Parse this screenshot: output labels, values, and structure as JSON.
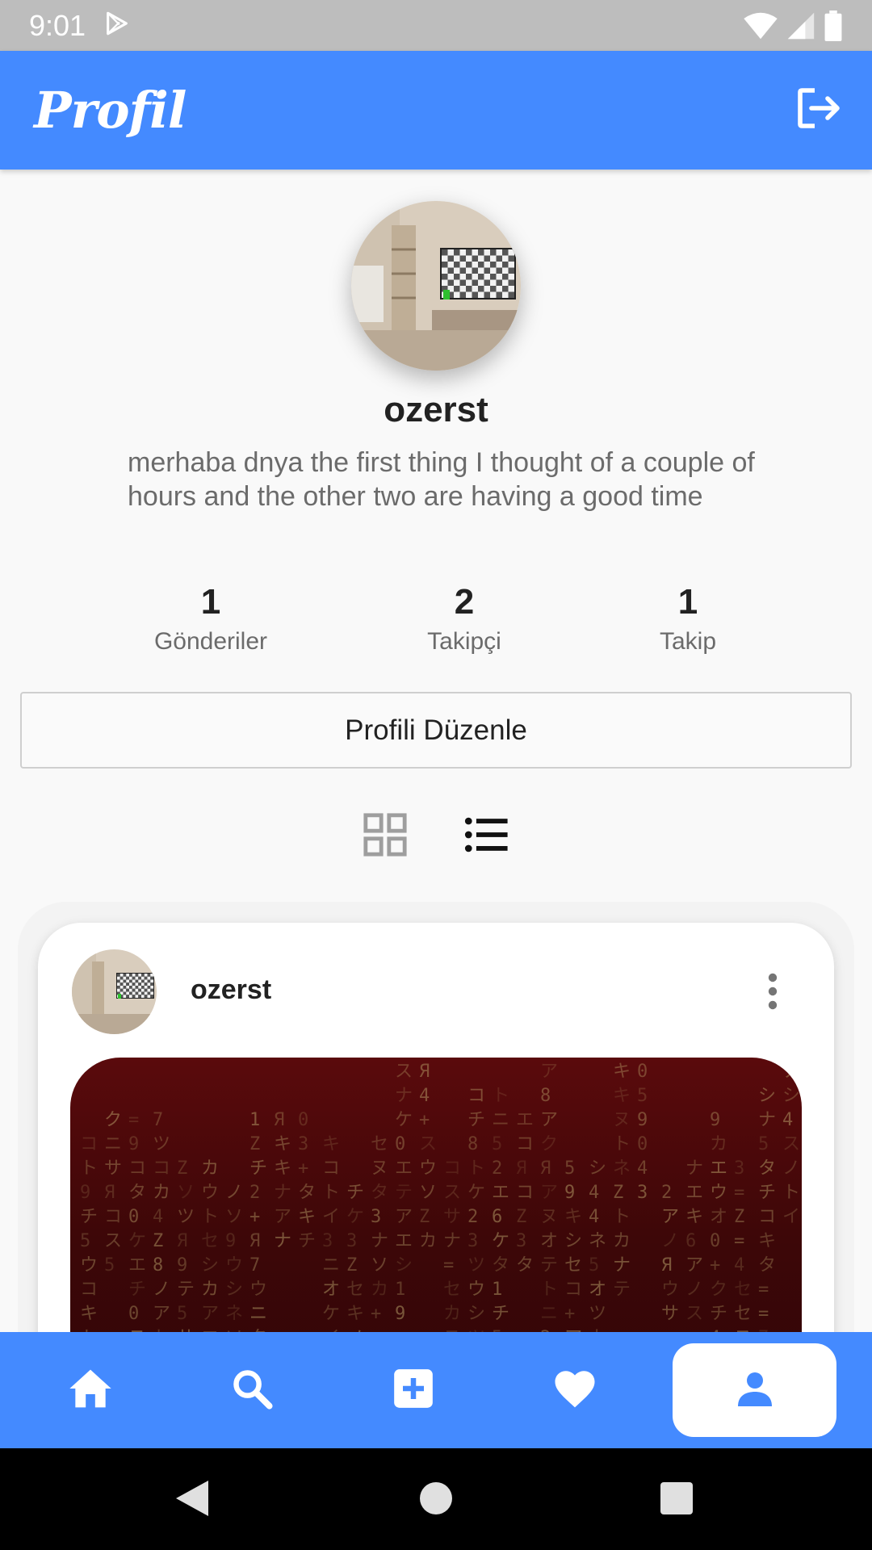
{
  "status_bar": {
    "time": "9:01",
    "icons": [
      "play-store-icon",
      "wifi-icon",
      "signal-icon",
      "battery-icon"
    ]
  },
  "app_bar": {
    "title": "Profil",
    "logout_icon": "logout-icon"
  },
  "profile": {
    "username": "ozerst",
    "bio": "merhaba dnya the first thing I thought of a couple of hours and the other two are having a good time",
    "stats": [
      {
        "value": "1",
        "label": "Gönderiler"
      },
      {
        "value": "2",
        "label": "Takipçi"
      },
      {
        "value": "1",
        "label": "Takip"
      }
    ],
    "edit_button": "Profili Düzenle"
  },
  "view_toggles": {
    "grid_icon": "grid-view-icon",
    "list_icon": "list-view-icon",
    "active": "list"
  },
  "post": {
    "username": "ozerst",
    "more_icon": "more-vert-icon"
  },
  "bottom_nav": {
    "items": [
      "home-icon",
      "search-icon",
      "add-box-icon",
      "heart-icon",
      "person-icon"
    ],
    "active": "person-icon"
  },
  "colors": {
    "primary": "#448aff",
    "status_bar": "#bdbdbd",
    "background": "#f9f9f9"
  }
}
